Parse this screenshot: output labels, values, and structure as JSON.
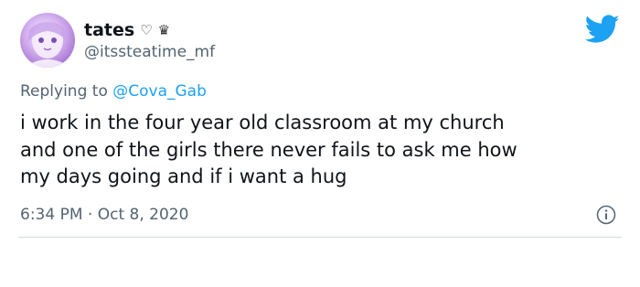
{
  "user": {
    "display_name": "tates",
    "name_icons": [
      "heart-outline-icon",
      "crown-icon"
    ],
    "heart_glyph": "♡",
    "crown_glyph": "♛",
    "handle": "@itssteatime_mf",
    "avatar": "anime-character-avatar"
  },
  "reply": {
    "prefix": "Replying to ",
    "mention": "@Cova_Gab"
  },
  "tweet": {
    "text": "i work in the four year old classroom at my church\nand one of the girls there never fails to ask me how\nmy days going and if i want a hug",
    "time": "6:34 PM",
    "separator": " · ",
    "date": "Oct 8, 2020"
  },
  "icons": {
    "brand": "twitter-bird-icon",
    "info": "info-icon"
  },
  "colors": {
    "twitter_blue": "#1da1f2",
    "text_primary": "#0f1419",
    "text_secondary": "#536471",
    "divider": "#cfd9de"
  }
}
